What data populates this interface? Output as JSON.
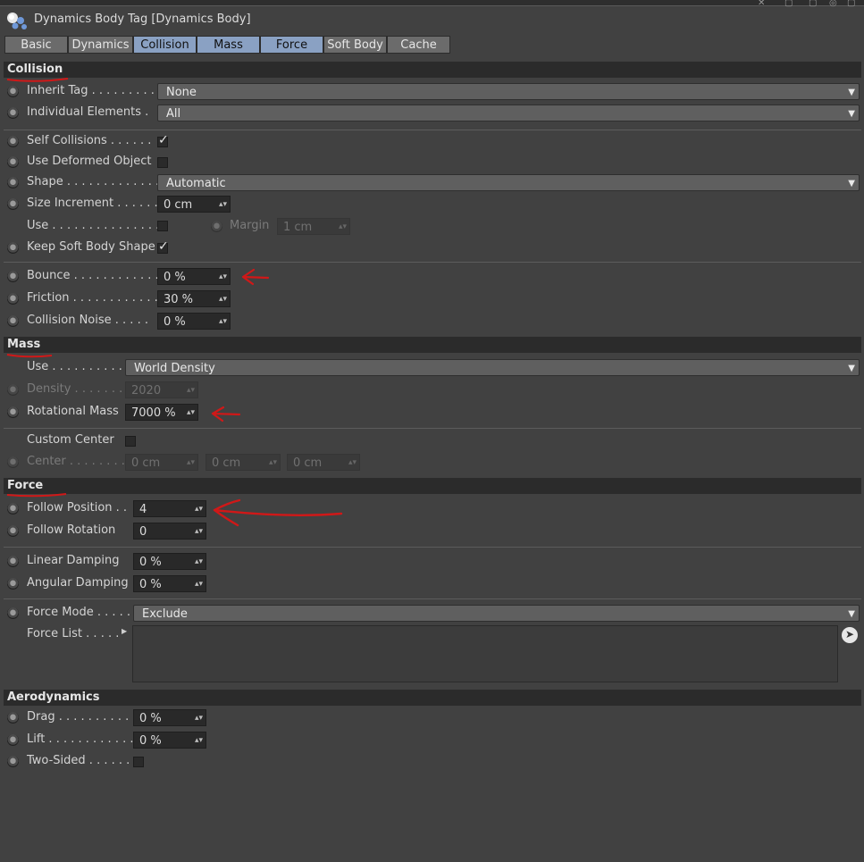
{
  "window": {
    "title": "Dynamics Body Tag [Dynamics Body]"
  },
  "tabs": [
    {
      "label": "Basic",
      "active": false
    },
    {
      "label": "Dynamics",
      "active": false
    },
    {
      "label": "Collision",
      "active": true
    },
    {
      "label": "Mass",
      "active": true
    },
    {
      "label": "Force",
      "active": true
    },
    {
      "label": "Soft Body",
      "active": false
    },
    {
      "label": "Cache",
      "active": false
    }
  ],
  "collision": {
    "header": "Collision",
    "inherit_tag": {
      "label": "Inherit Tag . . . . . . . . .",
      "value": "None"
    },
    "individual_elements": {
      "label": "Individual Elements .",
      "value": "All"
    },
    "self_collisions": {
      "label": "Self Collisions . . . . . .",
      "checked": true
    },
    "use_deformed_object": {
      "label": "Use Deformed Object",
      "checked": false
    },
    "shape": {
      "label": "Shape . . . . . . . . . . . . .",
      "value": "Automatic"
    },
    "size_increment": {
      "label": "Size Increment . . . . . .",
      "value": "0 cm"
    },
    "use": {
      "label": "Use . . . . . . . . . . . . . . .",
      "checked": false
    },
    "margin": {
      "label": "Margin",
      "value": "1 cm"
    },
    "keep_soft_body_shape": {
      "label": "Keep Soft Body Shape",
      "checked": true
    },
    "bounce": {
      "label": "Bounce . . . . . . . . . . . .",
      "value": "0 %"
    },
    "friction": {
      "label": "Friction . . . . . . . . . . . .",
      "value": "30 %"
    },
    "collision_noise": {
      "label": "Collision Noise . . . . .",
      "value": "0 %"
    }
  },
  "mass": {
    "header": "Mass",
    "use": {
      "label": "Use . . . . . . . . . . .",
      "value": "World Density"
    },
    "density": {
      "label": "Density . . . . . . . .",
      "value": "2020"
    },
    "rotational_mass": {
      "label": "Rotational Mass",
      "value": "7000 %"
    },
    "custom_center": {
      "label": "Custom Center",
      "checked": false
    },
    "center": {
      "label": "Center . . . . . . . . .",
      "x": "0 cm",
      "y": "0 cm",
      "z": "0 cm"
    }
  },
  "force": {
    "header": "Force",
    "follow_position": {
      "label": "Follow Position . .",
      "value": "4"
    },
    "follow_rotation": {
      "label": "Follow Rotation",
      "value": "0"
    },
    "linear_damping": {
      "label": "Linear Damping",
      "value": "0 %"
    },
    "angular_damping": {
      "label": "Angular Damping",
      "value": "0 %"
    },
    "force_mode": {
      "label": "Force Mode . . . . .",
      "value": "Exclude"
    },
    "force_list": {
      "label": "Force List . . . . ."
    }
  },
  "aerodynamics": {
    "header": "Aerodynamics",
    "drag": {
      "label": "Drag . . . . . . . . . . . .",
      "value": "0 %"
    },
    "lift": {
      "label": "Lift . . . . . . . . . . . . .",
      "value": "0 %"
    },
    "two_sided": {
      "label": "Two-Sided . . . . . .",
      "checked": false
    }
  },
  "colors": {
    "background": "#414141",
    "section_bar": "#2b2b2b",
    "active_tab": "#8aa1c3",
    "annotation": "#d01818"
  },
  "icons": {
    "tag": "dynamics-body-tag-icon",
    "picker": "pick-cursor-icon"
  }
}
